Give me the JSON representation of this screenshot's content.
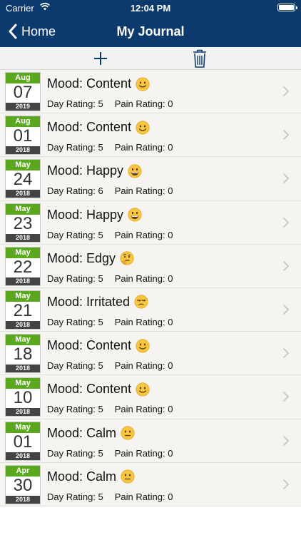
{
  "status": {
    "carrier": "Carrier",
    "time": "12:04 PM"
  },
  "nav": {
    "back_label": "Home",
    "title": "My Journal"
  },
  "colors": {
    "navbar": "#0d3a6c",
    "calendar_month": "#5aa81e",
    "calendar_year": "#444444",
    "toolbar_icon": "#0d3a6c"
  },
  "toolbar": {
    "add_icon": "plus-icon",
    "delete_icon": "trash-icon"
  },
  "entries": [
    {
      "month": "Aug",
      "day": "07",
      "year": "2019",
      "mood": "Mood: Content",
      "emoji": "slight-smile",
      "day_rating": "Day Rating: 5",
      "pain_rating": "Pain Rating: 0"
    },
    {
      "month": "Aug",
      "day": "01",
      "year": "2018",
      "mood": "Mood: Content",
      "emoji": "slight-smile",
      "day_rating": "Day Rating: 5",
      "pain_rating": "Pain Rating: 0"
    },
    {
      "month": "May",
      "day": "24",
      "year": "2018",
      "mood": "Mood: Happy",
      "emoji": "grin",
      "day_rating": "Day Rating: 6",
      "pain_rating": "Pain Rating: 0"
    },
    {
      "month": "May",
      "day": "23",
      "year": "2018",
      "mood": "Mood: Happy",
      "emoji": "grin",
      "day_rating": "Day Rating: 5",
      "pain_rating": "Pain Rating: 0"
    },
    {
      "month": "May",
      "day": "22",
      "year": "2018",
      "mood": "Mood: Edgy",
      "emoji": "thinking",
      "day_rating": "Day Rating: 5",
      "pain_rating": "Pain Rating: 0"
    },
    {
      "month": "May",
      "day": "21",
      "year": "2018",
      "mood": "Mood: Irritated",
      "emoji": "unamused",
      "day_rating": "Day Rating: 5",
      "pain_rating": "Pain Rating: 0"
    },
    {
      "month": "May",
      "day": "18",
      "year": "2018",
      "mood": "Mood: Content",
      "emoji": "slight-smile",
      "day_rating": "Day Rating: 5",
      "pain_rating": "Pain Rating: 0"
    },
    {
      "month": "May",
      "day": "10",
      "year": "2018",
      "mood": "Mood: Content",
      "emoji": "slight-smile",
      "day_rating": "Day Rating: 5",
      "pain_rating": "Pain Rating: 0"
    },
    {
      "month": "May",
      "day": "01",
      "year": "2018",
      "mood": "Mood: Calm",
      "emoji": "neutral",
      "day_rating": "Day Rating: 5",
      "pain_rating": "Pain Rating: 0"
    },
    {
      "month": "Apr",
      "day": "30",
      "year": "2018",
      "mood": "Mood: Calm",
      "emoji": "neutral",
      "day_rating": "Day Rating: 5",
      "pain_rating": "Pain Rating: 0"
    }
  ]
}
